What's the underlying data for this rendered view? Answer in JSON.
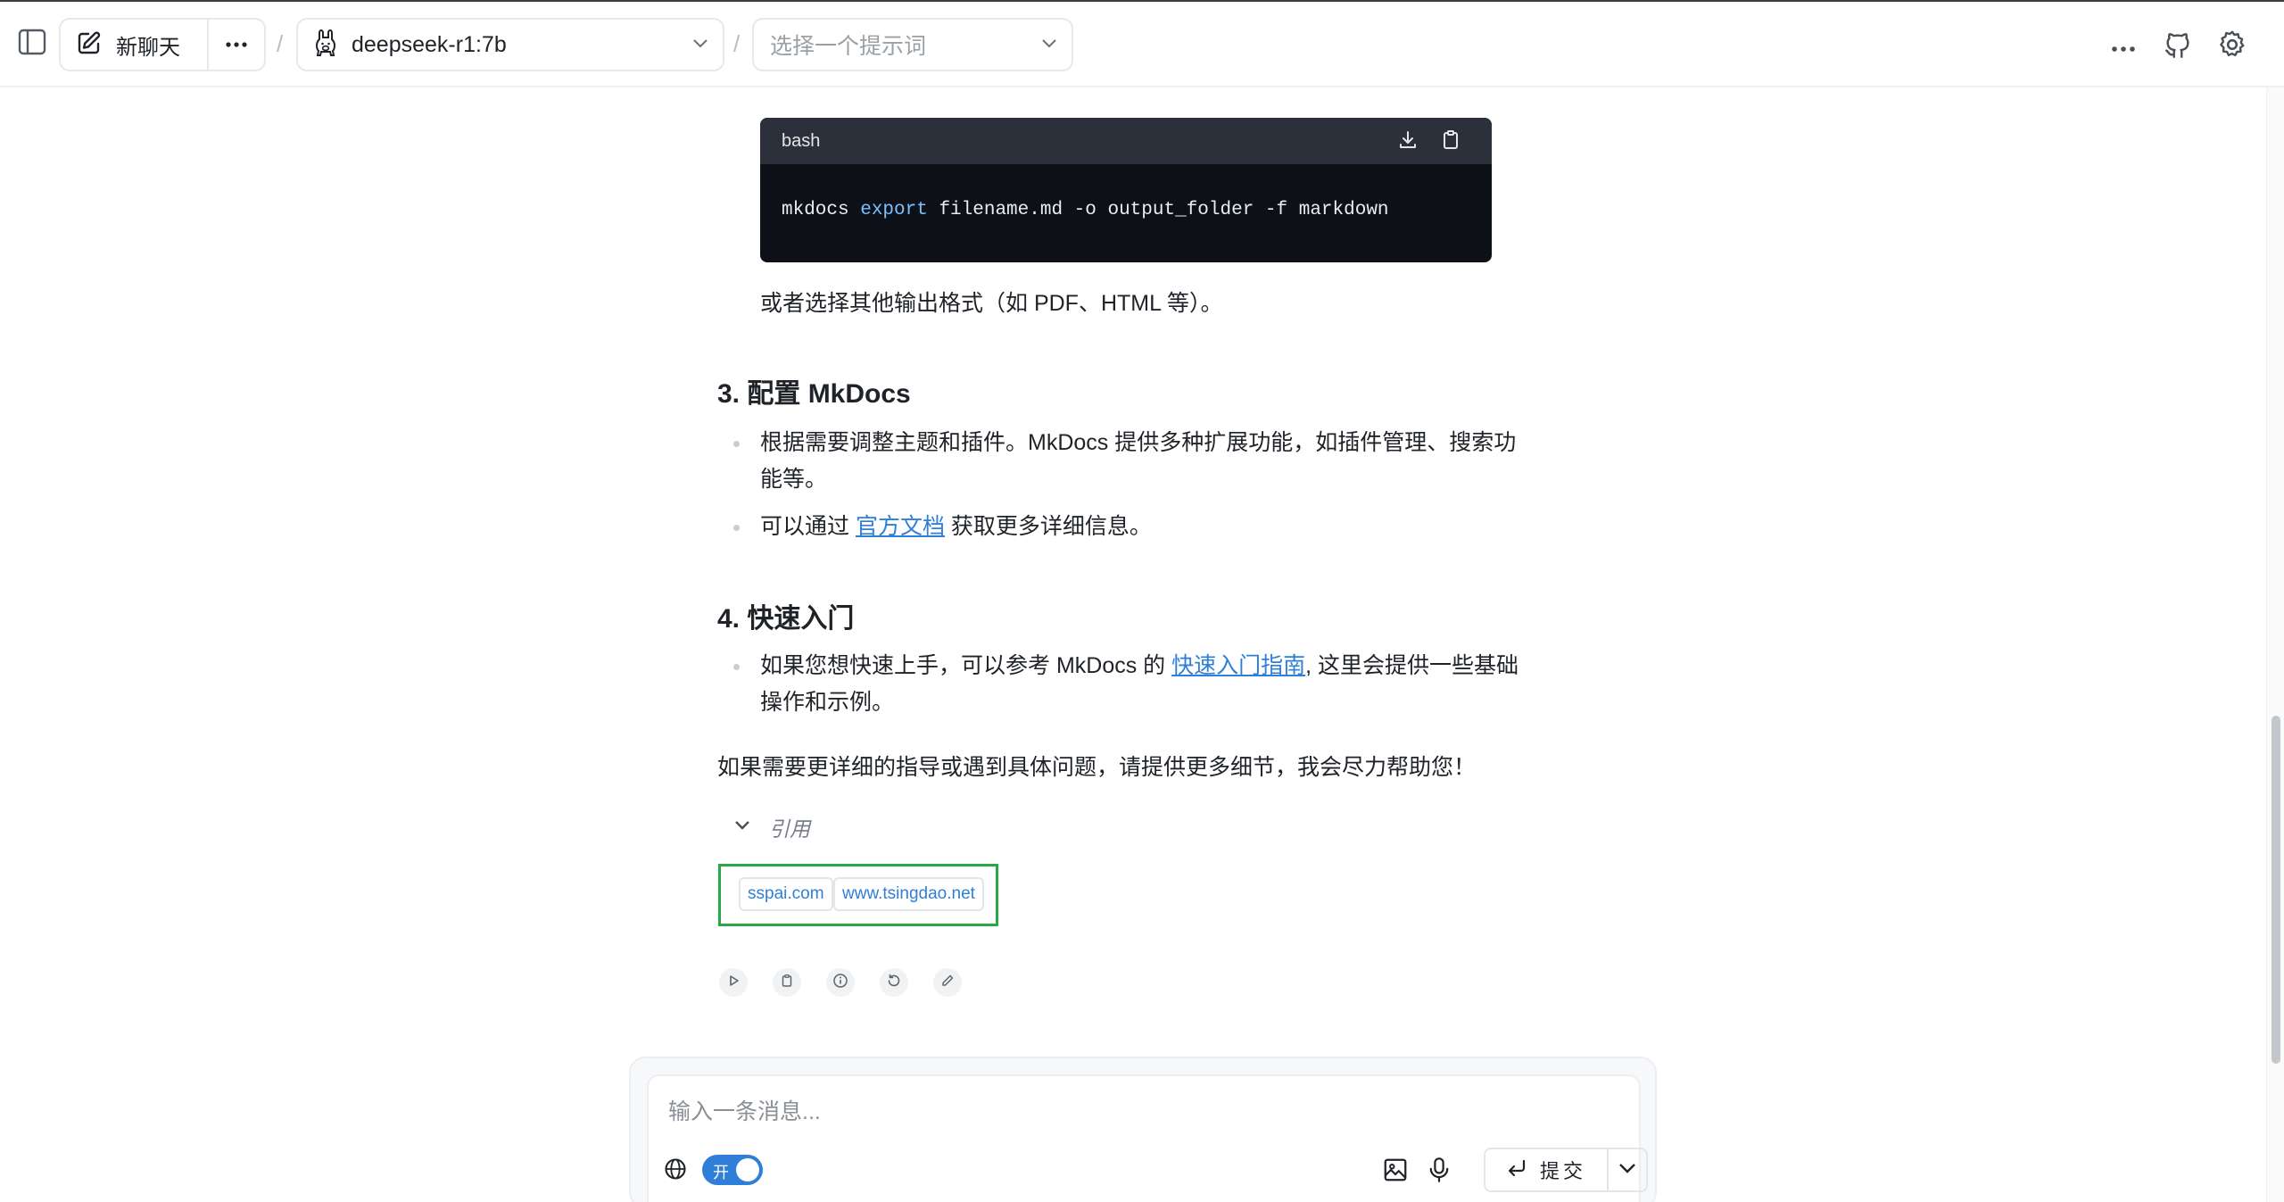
{
  "header": {
    "new_chat_label": "新聊天",
    "model_name": "deepseek-r1:7b",
    "prompt_placeholder": "选择一个提示词",
    "separator": "/"
  },
  "message": {
    "code": {
      "language": "bash",
      "tokens": [
        "mkdocs ",
        "export",
        " filename.md -o output_folder -f markdown"
      ]
    },
    "after_code": "或者选择其他输出格式（如 PDF、HTML 等）。",
    "section3": {
      "title": "3. 配置 MkDocs",
      "bullet1_line1": "根据需要调整主题和插件。MkDocs 提供多种扩展功能，如插件管理、搜索功",
      "bullet1_line2": "能等。",
      "bullet2_pre": "可以通过 ",
      "bullet2_link": "官方文档",
      "bullet2_post": " 获取更多详细信息。"
    },
    "section4": {
      "title": "4. 快速入门",
      "bullet1_pre": "如果您想快速上手，可以参考 MkDocs 的 ",
      "bullet1_link": "快速入门指南",
      "bullet1_post": ", 这里会提供一些基础",
      "bullet1_line2": "操作和示例。"
    },
    "closing": "如果需要更详细的指导或遇到具体问题，请提供更多细节，我会尽力帮助您！",
    "references_label": "引用",
    "references": [
      "sspai.com",
      "www.tsingdao.net"
    ]
  },
  "composer": {
    "placeholder": "输入一条消息...",
    "web_toggle_label": "开",
    "web_toggle_on": true,
    "submit_label": "提交"
  },
  "colors": {
    "accent": "#2f7fd8",
    "highlight_box": "#27a844",
    "code_bg": "#0d1117",
    "code_header_bg": "#2b303b",
    "code_keyword": "#79c0ff"
  }
}
